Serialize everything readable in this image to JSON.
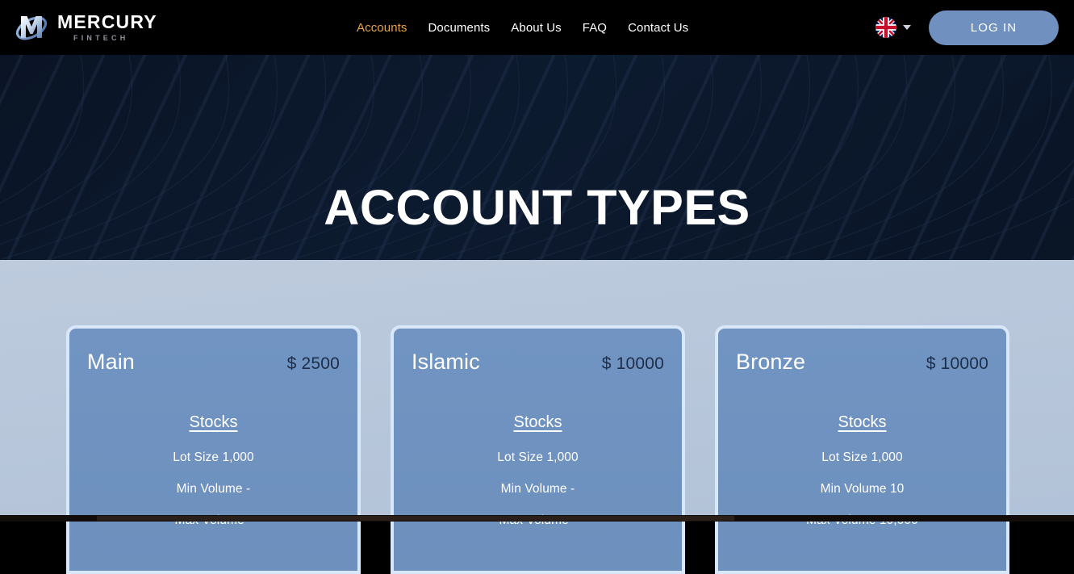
{
  "header": {
    "logo": {
      "name": "MERCURY",
      "sub": "FINTECH",
      "mark_icon": "mercury-m-orbit-logo"
    },
    "nav": [
      {
        "label": "Accounts",
        "active": true
      },
      {
        "label": "Documents",
        "active": false
      },
      {
        "label": "About Us",
        "active": false
      },
      {
        "label": "FAQ",
        "active": false
      },
      {
        "label": "Contact Us",
        "active": false
      }
    ],
    "language": {
      "flag_icon": "uk-flag-icon",
      "caret_icon": "chevron-down-icon"
    },
    "login_label": "LOG IN",
    "colors": {
      "background": "#000000",
      "active_nav": "#e8a243",
      "login_button": "#7091c0"
    }
  },
  "hero": {
    "title": "ACCOUNT TYPES",
    "background_color": "#0b1728"
  },
  "cards": [
    {
      "name": "Main",
      "price": "$ 2500",
      "section_title": "Stocks",
      "specs": [
        "Lot Size 1,000",
        "Min Volume -",
        "Max Volume -"
      ]
    },
    {
      "name": "Islamic",
      "price": "$ 10000",
      "section_title": "Stocks",
      "specs": [
        "Lot Size 1,000",
        "Min Volume -",
        "Max Volume -"
      ]
    },
    {
      "name": "Bronze",
      "price": "$ 10000",
      "section_title": "Stocks",
      "specs": [
        "Lot Size 1,000",
        "Min Volume 10",
        "Max Volume 10,000"
      ]
    }
  ],
  "section": {
    "background_color": "#b8c7da",
    "card_fill": "#7093c1",
    "card_border": "#d9e7fa"
  }
}
